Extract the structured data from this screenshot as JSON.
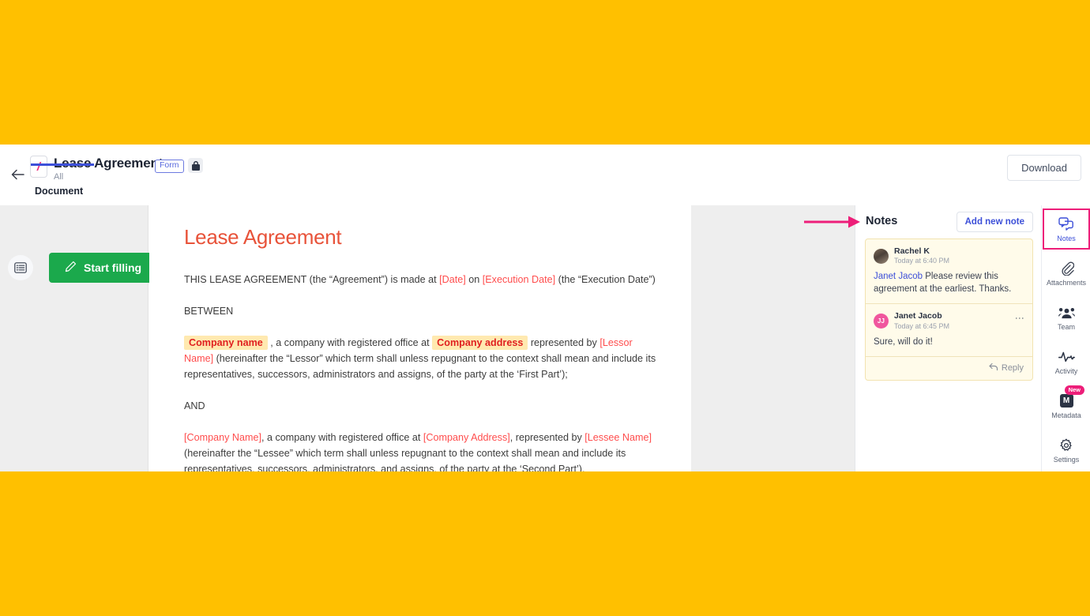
{
  "theme": {
    "background": "#FFC000",
    "accent_pink": "#ED1E79",
    "accent_blue": "#3C4FD8",
    "green": "#1BA94C",
    "doc_heading": "#E8533A",
    "placeholder_red": "#FF4D4D",
    "fill_highlight": "#FFE9B0"
  },
  "header": {
    "back_icon": "back-arrow-icon",
    "file_icon_glyph": "/",
    "title": "Lease Agreement",
    "badge": "Form",
    "lock_icon": "lock-icon",
    "subtitle": "All",
    "download_label": "Download",
    "tabs": [
      {
        "label": "Document",
        "active": true
      }
    ]
  },
  "left_pane": {
    "toc_icon": "table-of-contents-icon",
    "start_filling_label": "Start filling",
    "pen_icon": "pen-icon"
  },
  "document": {
    "heading": "Lease Agreement",
    "paragraphs": [
      {
        "id": "intro",
        "parts": [
          {
            "type": "text",
            "text": "THIS LEASE AGREEMENT (the “Agreement”) is made at "
          },
          {
            "type": "placeholder",
            "text": "[Date]"
          },
          {
            "type": "text",
            "text": " on "
          },
          {
            "type": "placeholder",
            "text": "[Execution Date]"
          },
          {
            "type": "text",
            "text": " (the “Execution Date”)"
          }
        ]
      },
      {
        "id": "between",
        "parts": [
          {
            "type": "text",
            "text": "BETWEEN"
          }
        ]
      },
      {
        "id": "lessor",
        "parts": [
          {
            "type": "fill",
            "text": "Company name"
          },
          {
            "type": "text",
            "text": " , a company with registered office at "
          },
          {
            "type": "fill",
            "text": "Company address"
          },
          {
            "type": "text",
            "text": " represented by "
          },
          {
            "type": "placeholder",
            "text": "[Lessor Name]"
          },
          {
            "type": "text",
            "text": " (hereinafter the “Lessor” which term shall unless repugnant to the context shall mean and include its representatives, successors, administrators and assigns, of the party at the ‘First Part’);"
          }
        ]
      },
      {
        "id": "and",
        "parts": [
          {
            "type": "text",
            "text": "AND"
          }
        ]
      },
      {
        "id": "lessee",
        "parts": [
          {
            "type": "placeholder",
            "text": "[Company Name]"
          },
          {
            "type": "text",
            "text": ", a company with registered office at "
          },
          {
            "type": "placeholder",
            "text": "[Company Address]"
          },
          {
            "type": "text",
            "text": ", represented by "
          },
          {
            "type": "placeholder",
            "text": "[Lessee Name]"
          },
          {
            "type": "text",
            "text": " (hereinafter the “Lessee” which term shall unless repugnant to the context shall mean and include its representatives, successors, administrators, and assigns, of the party at the ‘Second Part’)."
          }
        ]
      }
    ]
  },
  "notes": {
    "title": "Notes",
    "add_button": "Add new note",
    "items": [
      {
        "author": "Rachel K",
        "timestamp": "Today at 6:40 PM",
        "avatar_type": "photo",
        "avatar_initials": "",
        "mention": "Janet Jacob",
        "text": " Please review this agreement at the earliest. Thanks.",
        "has_menu": false
      },
      {
        "author": "Janet Jacob",
        "timestamp": "Today at 6:45 PM",
        "avatar_type": "initials",
        "avatar_initials": "JJ",
        "mention": "",
        "text": "Sure, will do it!",
        "has_menu": true
      }
    ],
    "reply_label": "Reply",
    "reply_icon": "reply-arrow-icon"
  },
  "rail": {
    "items": [
      {
        "label": "Notes",
        "icon": "notes-chat-icon",
        "active": true,
        "badge": ""
      },
      {
        "label": "Attachments",
        "icon": "paperclip-icon",
        "active": false,
        "badge": ""
      },
      {
        "label": "Team",
        "icon": "team-people-icon",
        "active": false,
        "badge": ""
      },
      {
        "label": "Activity",
        "icon": "activity-pulse-icon",
        "active": false,
        "badge": ""
      },
      {
        "label": "Metadata",
        "icon": "metadata-m-icon",
        "active": false,
        "badge": "New"
      },
      {
        "label": "Settings",
        "icon": "gear-icon",
        "active": false,
        "badge": ""
      }
    ]
  },
  "annotation": {
    "arrow": "pink-pointer-arrow"
  }
}
